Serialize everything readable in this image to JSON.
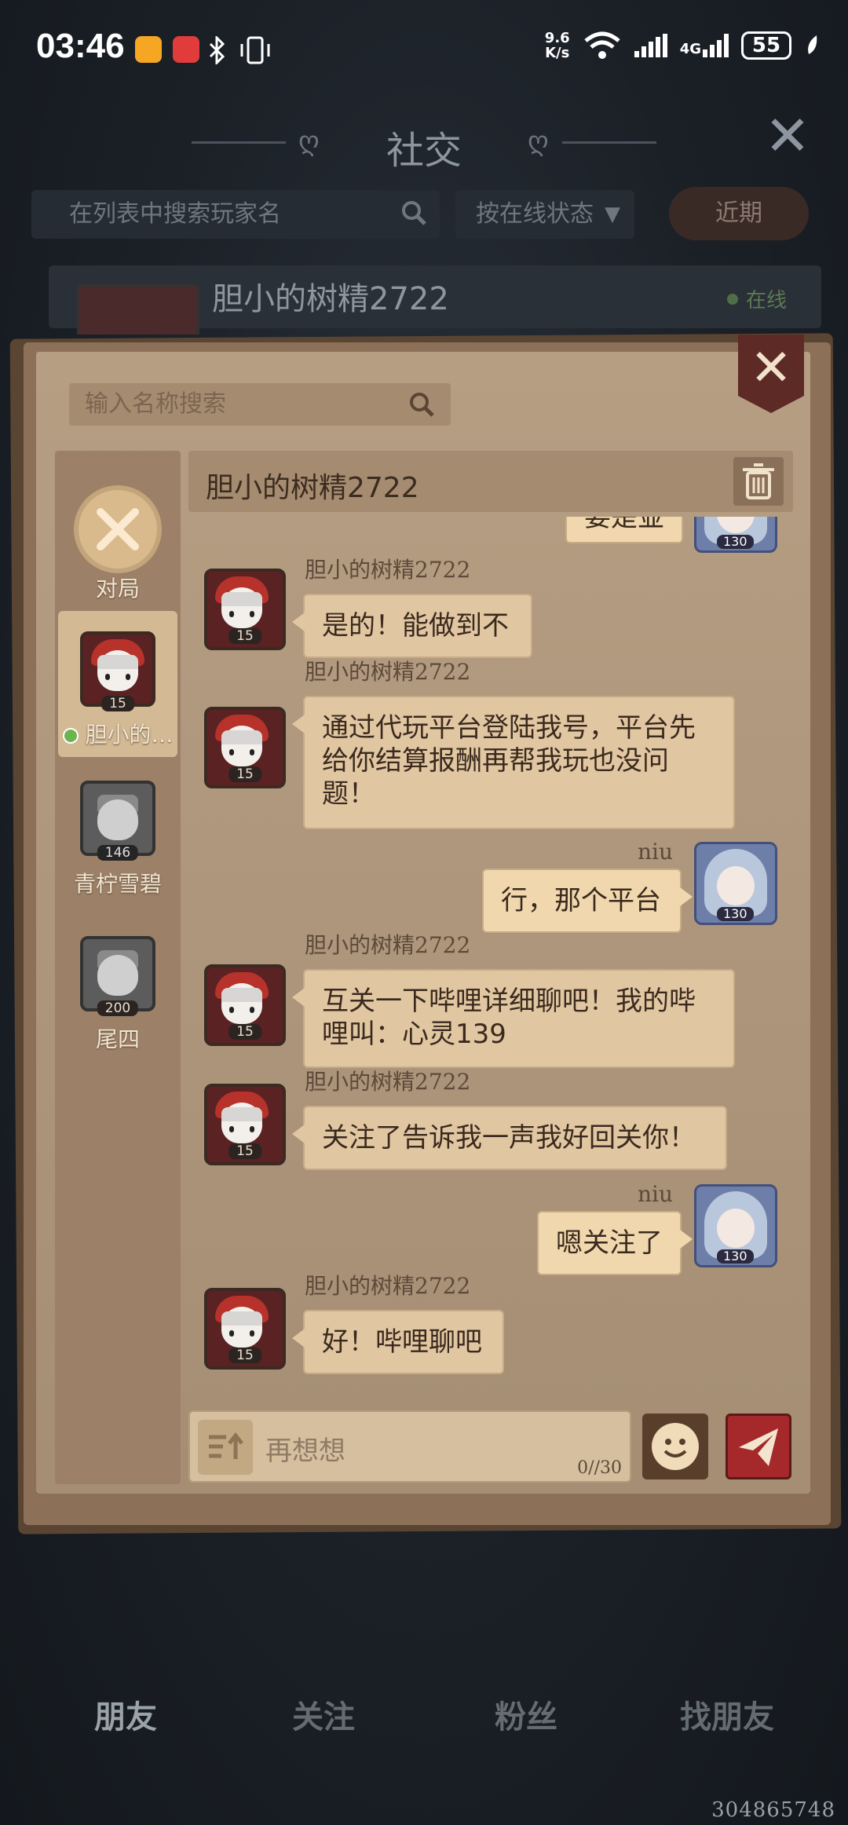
{
  "status_bar": {
    "time": "03:46",
    "speed_value": "9.6",
    "speed_unit": "K/s",
    "network": "4G",
    "battery": "55"
  },
  "social": {
    "title": "社交",
    "search_placeholder": "在列表中搜索玩家名",
    "filter_label": "按在线状态",
    "recent_button": "近期",
    "friend_name": "胆小的树精2722",
    "friend_status": "在线"
  },
  "modal": {
    "search_placeholder": "输入名称搜索",
    "contacts": [
      {
        "label": "对局"
      },
      {
        "label": "胆小的…",
        "level": "15"
      },
      {
        "label": "青柠雪碧",
        "level": "146"
      },
      {
        "label": "尾四",
        "level": "200"
      }
    ],
    "chat": {
      "header_name": "胆小的树精2722",
      "top_cut_text": "要是並",
      "my_level": "130",
      "messages": [
        {
          "sender": "胆小的树精2722",
          "level": "15",
          "text": "是的！能做到不",
          "mine": false
        },
        {
          "sender": "胆小的树精2722",
          "level": "15",
          "text": "通过代玩平台登陆我号，平台先给你结算报酬再帮我玩也没问题！",
          "mine": false
        },
        {
          "sender": "niu",
          "level": "130",
          "text": "行，那个平台",
          "mine": true
        },
        {
          "sender": "胆小的树精2722",
          "level": "15",
          "text": "互关一下哔哩详细聊吧！我的哔哩叫：心灵139",
          "mine": false
        },
        {
          "sender": "胆小的树精2722",
          "level": "15",
          "text": "关注了告诉我一声我好回关你！",
          "mine": false
        },
        {
          "sender": "niu",
          "level": "130",
          "text": "嗯关注了",
          "mine": true
        },
        {
          "sender": "胆小的树精2722",
          "level": "15",
          "text": "好！哔哩聊吧",
          "mine": false
        }
      ],
      "input_placeholder": "再想想",
      "input_count": "0//30"
    }
  },
  "tabs": [
    "朋友",
    "关注",
    "粉丝",
    "找朋友"
  ],
  "uid": "304865748"
}
